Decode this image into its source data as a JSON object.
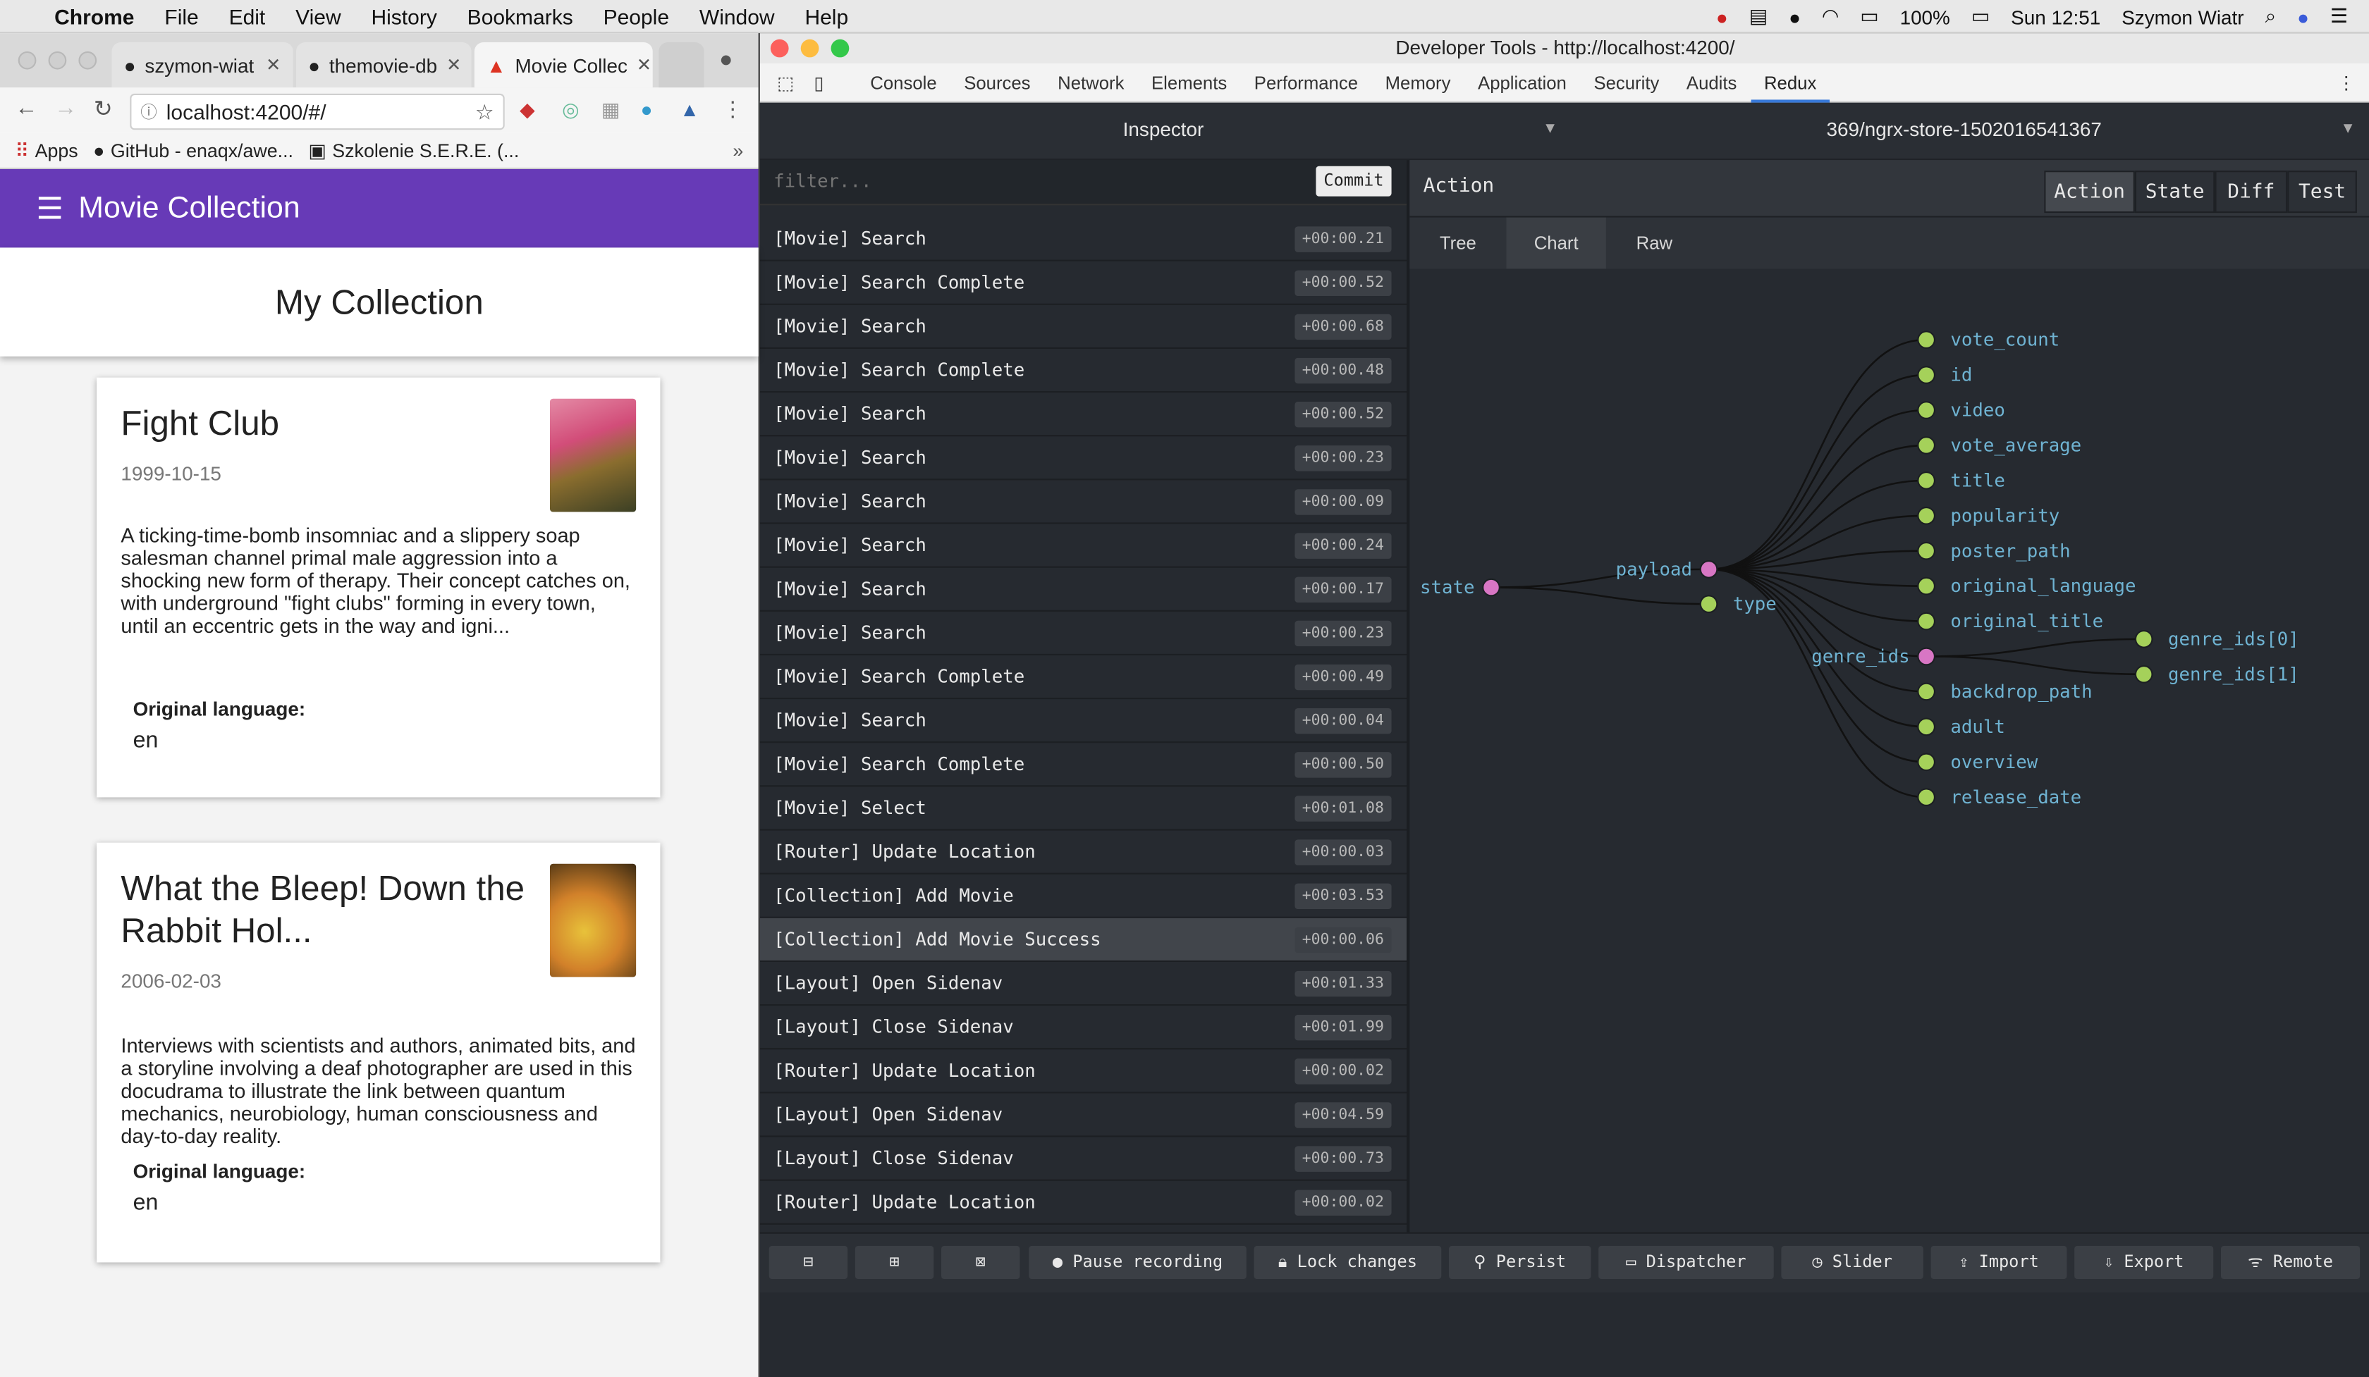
{
  "menubar": {
    "app": "Chrome",
    "items": [
      "File",
      "Edit",
      "View",
      "History",
      "Bookmarks",
      "People",
      "Window",
      "Help"
    ],
    "battery": "100%",
    "clock": "Sun 12:51",
    "user": "Szymon Wiatr"
  },
  "chrome": {
    "tabs": [
      {
        "label": "szymon-wiat",
        "icon": "github-icon"
      },
      {
        "label": "themovie-db",
        "icon": "github-icon"
      },
      {
        "label": "Movie Collec",
        "icon": "angular-icon"
      }
    ],
    "url": "localhost:4200/#/",
    "bookmarks": [
      "Apps",
      "GitHub - enaqx/awe...",
      "Szkolenie S.E.R.E. (..."
    ]
  },
  "app": {
    "title": "Movie Collection",
    "page_title": "My Collection",
    "movies": [
      {
        "title": "Fight Club",
        "date": "1999-10-15",
        "description": "A ticking-time-bomb insomniac and a slippery soap salesman channel primal male aggression into a shocking new form of therapy. Their concept catches on, with underground \"fight clubs\" forming in every town, until an eccentric gets in the way and igni...",
        "lang_label": "Original language:",
        "lang": "en"
      },
      {
        "title": "What the Bleep! Down the Rabbit Hol...",
        "date": "2006-02-03",
        "description": "Interviews with scientists and authors, animated bits, and a storyline involving a deaf photographer are used in this docudrama to illustrate the link between quantum mechanics, neurobiology, human consciousness and day-to-day reality.",
        "lang_label": "Original language:",
        "lang": "en"
      }
    ]
  },
  "devtools": {
    "title": "Developer Tools - http://localhost:4200/",
    "tabs": [
      "Console",
      "Sources",
      "Network",
      "Elements",
      "Performance",
      "Memory",
      "Application",
      "Security",
      "Audits",
      "Redux"
    ],
    "active_tab": "Redux",
    "monitor": "Inspector",
    "instance": "369/ngrx-store-1502016541367",
    "filter_placeholder": "filter...",
    "commit_label": "Commit",
    "actions": [
      {
        "name": "[Movie] Search",
        "time": "+00:00.21"
      },
      {
        "name": "[Movie] Search Complete",
        "time": "+00:00.52"
      },
      {
        "name": "[Movie] Search",
        "time": "+00:00.68"
      },
      {
        "name": "[Movie] Search Complete",
        "time": "+00:00.48"
      },
      {
        "name": "[Movie] Search",
        "time": "+00:00.52"
      },
      {
        "name": "[Movie] Search",
        "time": "+00:00.23"
      },
      {
        "name": "[Movie] Search",
        "time": "+00:00.09"
      },
      {
        "name": "[Movie] Search",
        "time": "+00:00.24"
      },
      {
        "name": "[Movie] Search",
        "time": "+00:00.17"
      },
      {
        "name": "[Movie] Search",
        "time": "+00:00.23"
      },
      {
        "name": "[Movie] Search Complete",
        "time": "+00:00.49"
      },
      {
        "name": "[Movie] Search",
        "time": "+00:00.04"
      },
      {
        "name": "[Movie] Search Complete",
        "time": "+00:00.50"
      },
      {
        "name": "[Movie] Select",
        "time": "+00:01.08"
      },
      {
        "name": "[Router] Update Location",
        "time": "+00:00.03"
      },
      {
        "name": "[Collection] Add Movie",
        "time": "+00:03.53"
      },
      {
        "name": "[Collection] Add Movie Success",
        "time": "+00:00.06"
      },
      {
        "name": "[Layout] Open Sidenav",
        "time": "+00:01.33"
      },
      {
        "name": "[Layout] Close Sidenav",
        "time": "+00:01.99"
      },
      {
        "name": "[Router] Update Location",
        "time": "+00:00.02"
      },
      {
        "name": "[Layout] Open Sidenav",
        "time": "+00:04.59"
      },
      {
        "name": "[Layout] Close Sidenav",
        "time": "+00:00.73"
      },
      {
        "name": "[Router] Update Location",
        "time": "+00:00.02"
      }
    ],
    "selected_action_index": 16,
    "pane_title": "Action",
    "pane_buttons": [
      "Action",
      "State",
      "Diff",
      "Test"
    ],
    "active_pane_button": "Action",
    "view_tabs": [
      "Tree",
      "Chart",
      "Raw"
    ],
    "active_view_tab": "Chart",
    "tree": {
      "root": "state",
      "level1": [
        "payload",
        "type"
      ],
      "payload_keys": [
        "vote_count",
        "id",
        "video",
        "vote_average",
        "title",
        "popularity",
        "poster_path",
        "original_language",
        "original_title",
        "genre_ids",
        "backdrop_path",
        "adult",
        "overview",
        "release_date"
      ],
      "genre_children": [
        "genre_ids[0]",
        "genre_ids[1]"
      ]
    },
    "bottom_buttons": [
      "Pause recording",
      "Lock changes",
      "Persist",
      "Dispatcher",
      "Slider",
      "Import",
      "Export",
      "Remote"
    ],
    "colors": {
      "branch": "#d876c4",
      "leaf": "#a5d15a",
      "label": "#6fb3d2",
      "bg": "#262a30"
    }
  }
}
